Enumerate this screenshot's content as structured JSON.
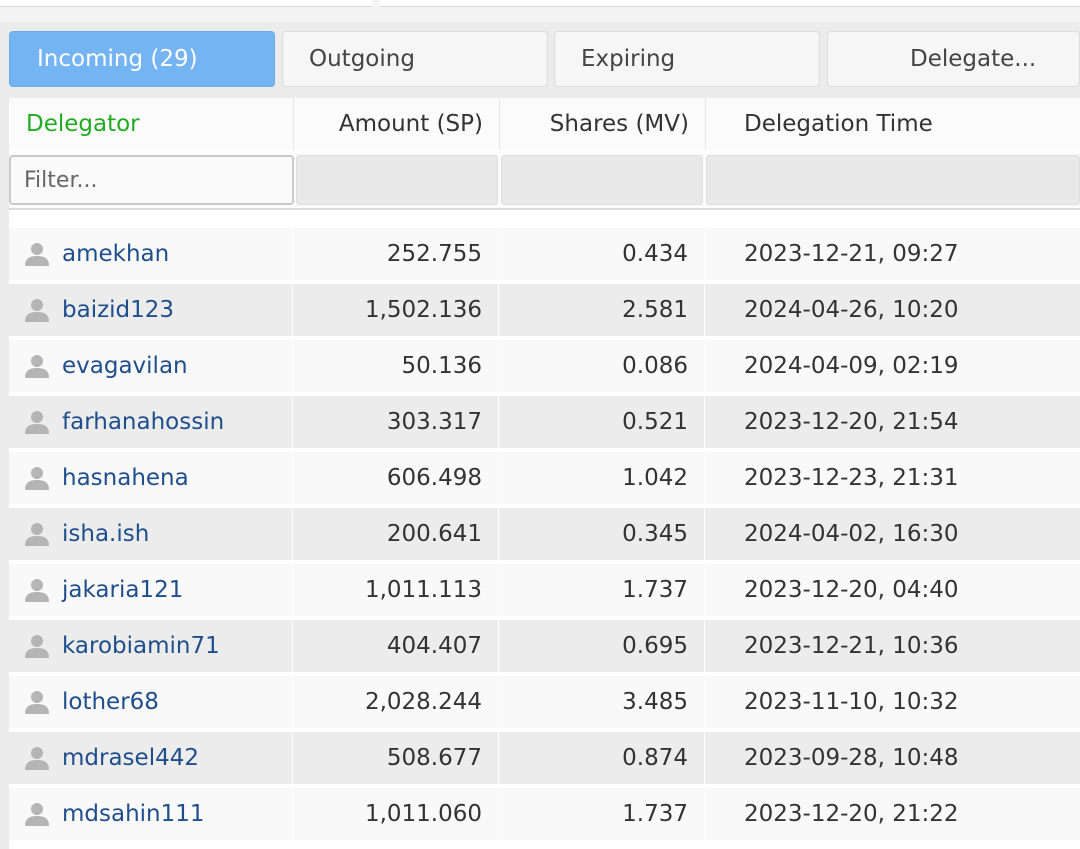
{
  "tabs": [
    {
      "label": "Incoming (29)",
      "active": true
    },
    {
      "label": "Outgoing",
      "active": false
    },
    {
      "label": "Expiring",
      "active": false
    },
    {
      "label": "Delegate...",
      "active": false
    }
  ],
  "table": {
    "columns": [
      "Delegator",
      "Amount (SP)",
      "Shares (MV)",
      "Delegation Time"
    ],
    "filter_placeholder": "Filter...",
    "rows": [
      {
        "delegator": "amekhan",
        "amount": "252.755",
        "shares": "0.434",
        "time": "2023-12-21, 09:27"
      },
      {
        "delegator": "baizid123",
        "amount": "1,502.136",
        "shares": "2.581",
        "time": "2024-04-26, 10:20"
      },
      {
        "delegator": "evagavilan",
        "amount": "50.136",
        "shares": "0.086",
        "time": "2024-04-09, 02:19"
      },
      {
        "delegator": "farhanahossin",
        "amount": "303.317",
        "shares": "0.521",
        "time": "2023-12-20, 21:54"
      },
      {
        "delegator": "hasnahena",
        "amount": "606.498",
        "shares": "1.042",
        "time": "2023-12-23, 21:31"
      },
      {
        "delegator": "isha.ish",
        "amount": "200.641",
        "shares": "0.345",
        "time": "2024-04-02, 16:30"
      },
      {
        "delegator": "jakaria121",
        "amount": "1,011.113",
        "shares": "1.737",
        "time": "2023-12-20, 04:40"
      },
      {
        "delegator": "karobiamin71",
        "amount": "404.407",
        "shares": "0.695",
        "time": "2023-12-21, 10:36"
      },
      {
        "delegator": "lother68",
        "amount": "2,028.244",
        "shares": "3.485",
        "time": "2023-11-10, 10:32"
      },
      {
        "delegator": "mdrasel442",
        "amount": "508.677",
        "shares": "0.874",
        "time": "2023-09-28, 10:48"
      },
      {
        "delegator": "mdsahin111",
        "amount": "1,011.060",
        "shares": "1.737",
        "time": "2023-12-20, 21:22"
      }
    ]
  },
  "colors": {
    "active_tab": "#74b4f2",
    "delegator_header": "#22aa22",
    "link": "#1f4e8c",
    "row_alt": "#ececec"
  },
  "icons": {
    "row_icon": "user-icon"
  }
}
